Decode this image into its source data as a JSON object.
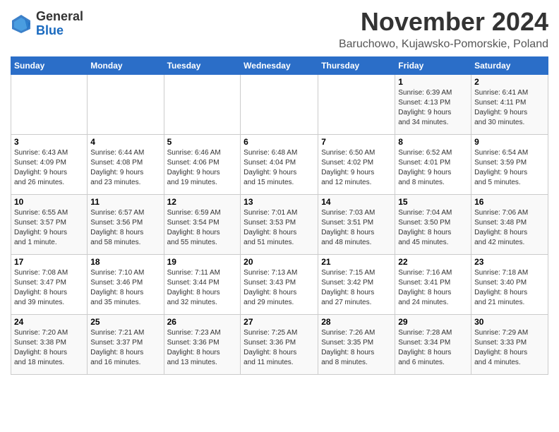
{
  "logo": {
    "general": "General",
    "blue": "Blue"
  },
  "title": "November 2024",
  "subtitle": "Baruchowo, Kujawsko-Pomorskie, Poland",
  "days_of_week": [
    "Sunday",
    "Monday",
    "Tuesday",
    "Wednesday",
    "Thursday",
    "Friday",
    "Saturday"
  ],
  "weeks": [
    [
      {
        "day": "",
        "info": ""
      },
      {
        "day": "",
        "info": ""
      },
      {
        "day": "",
        "info": ""
      },
      {
        "day": "",
        "info": ""
      },
      {
        "day": "",
        "info": ""
      },
      {
        "day": "1",
        "info": "Sunrise: 6:39 AM\nSunset: 4:13 PM\nDaylight: 9 hours\nand 34 minutes."
      },
      {
        "day": "2",
        "info": "Sunrise: 6:41 AM\nSunset: 4:11 PM\nDaylight: 9 hours\nand 30 minutes."
      }
    ],
    [
      {
        "day": "3",
        "info": "Sunrise: 6:43 AM\nSunset: 4:09 PM\nDaylight: 9 hours\nand 26 minutes."
      },
      {
        "day": "4",
        "info": "Sunrise: 6:44 AM\nSunset: 4:08 PM\nDaylight: 9 hours\nand 23 minutes."
      },
      {
        "day": "5",
        "info": "Sunrise: 6:46 AM\nSunset: 4:06 PM\nDaylight: 9 hours\nand 19 minutes."
      },
      {
        "day": "6",
        "info": "Sunrise: 6:48 AM\nSunset: 4:04 PM\nDaylight: 9 hours\nand 15 minutes."
      },
      {
        "day": "7",
        "info": "Sunrise: 6:50 AM\nSunset: 4:02 PM\nDaylight: 9 hours\nand 12 minutes."
      },
      {
        "day": "8",
        "info": "Sunrise: 6:52 AM\nSunset: 4:01 PM\nDaylight: 9 hours\nand 8 minutes."
      },
      {
        "day": "9",
        "info": "Sunrise: 6:54 AM\nSunset: 3:59 PM\nDaylight: 9 hours\nand 5 minutes."
      }
    ],
    [
      {
        "day": "10",
        "info": "Sunrise: 6:55 AM\nSunset: 3:57 PM\nDaylight: 9 hours\nand 1 minute."
      },
      {
        "day": "11",
        "info": "Sunrise: 6:57 AM\nSunset: 3:56 PM\nDaylight: 8 hours\nand 58 minutes."
      },
      {
        "day": "12",
        "info": "Sunrise: 6:59 AM\nSunset: 3:54 PM\nDaylight: 8 hours\nand 55 minutes."
      },
      {
        "day": "13",
        "info": "Sunrise: 7:01 AM\nSunset: 3:53 PM\nDaylight: 8 hours\nand 51 minutes."
      },
      {
        "day": "14",
        "info": "Sunrise: 7:03 AM\nSunset: 3:51 PM\nDaylight: 8 hours\nand 48 minutes."
      },
      {
        "day": "15",
        "info": "Sunrise: 7:04 AM\nSunset: 3:50 PM\nDaylight: 8 hours\nand 45 minutes."
      },
      {
        "day": "16",
        "info": "Sunrise: 7:06 AM\nSunset: 3:48 PM\nDaylight: 8 hours\nand 42 minutes."
      }
    ],
    [
      {
        "day": "17",
        "info": "Sunrise: 7:08 AM\nSunset: 3:47 PM\nDaylight: 8 hours\nand 39 minutes."
      },
      {
        "day": "18",
        "info": "Sunrise: 7:10 AM\nSunset: 3:46 PM\nDaylight: 8 hours\nand 35 minutes."
      },
      {
        "day": "19",
        "info": "Sunrise: 7:11 AM\nSunset: 3:44 PM\nDaylight: 8 hours\nand 32 minutes."
      },
      {
        "day": "20",
        "info": "Sunrise: 7:13 AM\nSunset: 3:43 PM\nDaylight: 8 hours\nand 29 minutes."
      },
      {
        "day": "21",
        "info": "Sunrise: 7:15 AM\nSunset: 3:42 PM\nDaylight: 8 hours\nand 27 minutes."
      },
      {
        "day": "22",
        "info": "Sunrise: 7:16 AM\nSunset: 3:41 PM\nDaylight: 8 hours\nand 24 minutes."
      },
      {
        "day": "23",
        "info": "Sunrise: 7:18 AM\nSunset: 3:40 PM\nDaylight: 8 hours\nand 21 minutes."
      }
    ],
    [
      {
        "day": "24",
        "info": "Sunrise: 7:20 AM\nSunset: 3:38 PM\nDaylight: 8 hours\nand 18 minutes."
      },
      {
        "day": "25",
        "info": "Sunrise: 7:21 AM\nSunset: 3:37 PM\nDaylight: 8 hours\nand 16 minutes."
      },
      {
        "day": "26",
        "info": "Sunrise: 7:23 AM\nSunset: 3:36 PM\nDaylight: 8 hours\nand 13 minutes."
      },
      {
        "day": "27",
        "info": "Sunrise: 7:25 AM\nSunset: 3:36 PM\nDaylight: 8 hours\nand 11 minutes."
      },
      {
        "day": "28",
        "info": "Sunrise: 7:26 AM\nSunset: 3:35 PM\nDaylight: 8 hours\nand 8 minutes."
      },
      {
        "day": "29",
        "info": "Sunrise: 7:28 AM\nSunset: 3:34 PM\nDaylight: 8 hours\nand 6 minutes."
      },
      {
        "day": "30",
        "info": "Sunrise: 7:29 AM\nSunset: 3:33 PM\nDaylight: 8 hours\nand 4 minutes."
      }
    ]
  ]
}
